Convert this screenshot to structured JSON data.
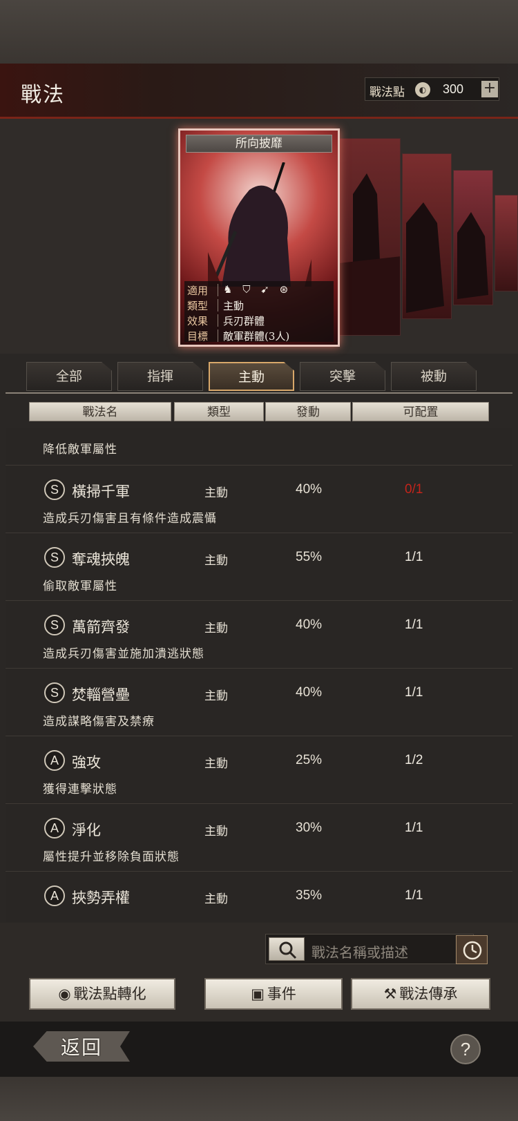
{
  "header": {
    "title": "戰法",
    "points_label": "戰法點",
    "points_coin": "◐",
    "points_value": "300",
    "plus": "+"
  },
  "card": {
    "title": "所向披靡",
    "stats": [
      {
        "key": "適用",
        "value": ""
      },
      {
        "key": "類型",
        "value": "主動"
      },
      {
        "key": "效果",
        "value": "兵刃群體"
      },
      {
        "key": "目標",
        "value": "敵軍群體(3人)"
      }
    ],
    "suit_icons": [
      "cavalry-icon",
      "shield-icon",
      "archer-icon",
      "siege-icon"
    ]
  },
  "tabs": [
    "全部",
    "指揮",
    "主動",
    "突擊",
    "被動"
  ],
  "active_tab": "主動",
  "columns": [
    "戰法名",
    "類型",
    "發動",
    "可配置"
  ],
  "list": {
    "partial_desc": "降低敵軍屬性",
    "rows": [
      {
        "grade": "S",
        "name": "橫掃千軍",
        "type": "主動",
        "rate": "40%",
        "slots": "0/1",
        "full": true,
        "desc": "造成兵刃傷害且有條件造成震懾"
      },
      {
        "grade": "S",
        "name": "奪魂挾魄",
        "type": "主動",
        "rate": "55%",
        "slots": "1/1",
        "full": false,
        "desc": "偷取敵軍屬性"
      },
      {
        "grade": "S",
        "name": "萬箭齊發",
        "type": "主動",
        "rate": "40%",
        "slots": "1/1",
        "full": false,
        "desc": "造成兵刃傷害並施加潰逃狀態"
      },
      {
        "grade": "S",
        "name": "焚輜營壘",
        "type": "主動",
        "rate": "40%",
        "slots": "1/1",
        "full": false,
        "desc": "造成謀略傷害及禁療"
      },
      {
        "grade": "A",
        "name": "強攻",
        "type": "主動",
        "rate": "25%",
        "slots": "1/2",
        "full": false,
        "desc": "獲得連擊狀態"
      },
      {
        "grade": "A",
        "name": "淨化",
        "type": "主動",
        "rate": "30%",
        "slots": "1/1",
        "full": false,
        "desc": "屬性提升並移除負面狀態"
      },
      {
        "grade": "A",
        "name": "挾勢弄權",
        "type": "主動",
        "rate": "35%",
        "slots": "1/1",
        "full": false,
        "desc": ""
      }
    ]
  },
  "search": {
    "placeholder": "戰法名稱或描述"
  },
  "buttons": {
    "convert": "戰法點轉化",
    "events": "事件",
    "inherit": "戰法傳承"
  },
  "footer": {
    "back": "返回",
    "help": "?"
  }
}
